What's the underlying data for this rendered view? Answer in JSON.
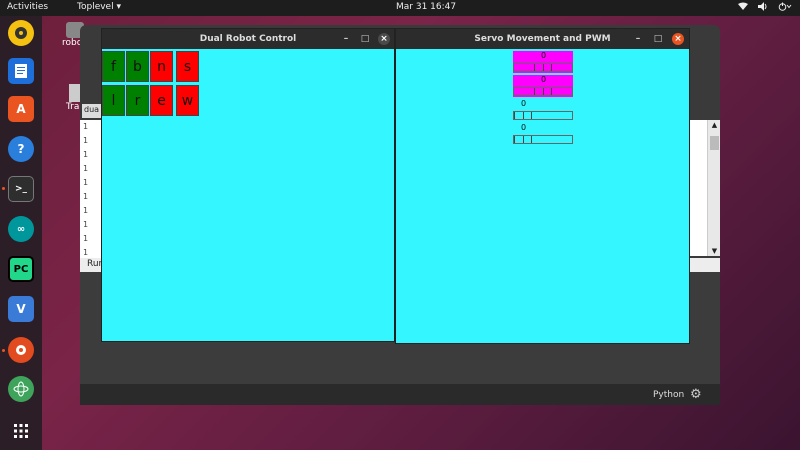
{
  "topbar": {
    "activities": "Activities",
    "app_menu": "Toplevel ▾",
    "clock": "Mar 31  16:47",
    "tray_icons": [
      "network-icon",
      "volume-icon",
      "power-icon"
    ]
  },
  "dock": {
    "items": [
      {
        "name": "rhythmbox",
        "color": "#f5c211"
      },
      {
        "name": "writer",
        "color": "#1e6fd9"
      },
      {
        "name": "software",
        "color": "#e95420"
      },
      {
        "name": "help",
        "color": "#2a7fdc"
      },
      {
        "name": "terminal",
        "color": "#2e2e2e",
        "glyph": ">_"
      },
      {
        "name": "arduino",
        "color": "#00979c"
      },
      {
        "name": "pycharm",
        "color": "#21d789",
        "glyph": "PC"
      },
      {
        "name": "vnc",
        "color": "#3b7bd8",
        "glyph": "V"
      },
      {
        "name": "thonny",
        "color": "#e24a1f"
      },
      {
        "name": "atom",
        "color": "#3fa45b"
      }
    ],
    "apps_grid_icon": "apps-grid-icon"
  },
  "desktop": {
    "icons": [
      {
        "label": "robo"
      },
      {
        "label": "Mo"
      },
      {
        "label": "Tra"
      }
    ]
  },
  "main_window": {
    "tab_label": "dua",
    "list_lines": [
      "1",
      "1",
      "1",
      "1",
      "1",
      "1",
      "1",
      "1",
      "1",
      "1"
    ],
    "run_label": "Run",
    "status_interpreter": "Python"
  },
  "window1": {
    "title": "Dual Robot Control",
    "minimize": "–",
    "maximize": "□",
    "close": "×",
    "keys_row1": [
      {
        "label": "f",
        "color": "green"
      },
      {
        "label": "b",
        "color": "green"
      },
      {
        "label": "n",
        "color": "red"
      },
      {
        "label": "s",
        "color": "red"
      }
    ],
    "keys_row2": [
      {
        "label": "l",
        "color": "green"
      },
      {
        "label": "r",
        "color": "green"
      },
      {
        "label": "e",
        "color": "red"
      },
      {
        "label": "w",
        "color": "red"
      }
    ]
  },
  "window2": {
    "title": "Servo Movement and PWM",
    "minimize": "–",
    "maximize": "□",
    "close": "×",
    "servos": [
      {
        "value": "0",
        "color": "magenta"
      },
      {
        "value": "0",
        "color": "magenta"
      },
      {
        "value": "0",
        "color": "cyan"
      },
      {
        "value": "0",
        "color": "cyan"
      }
    ]
  },
  "colors": {
    "canvas": "#33f6ff",
    "key_green": "#008000",
    "key_red": "#ff0000",
    "servo_magenta": "#ff00ff",
    "close_orange": "#e95420"
  }
}
